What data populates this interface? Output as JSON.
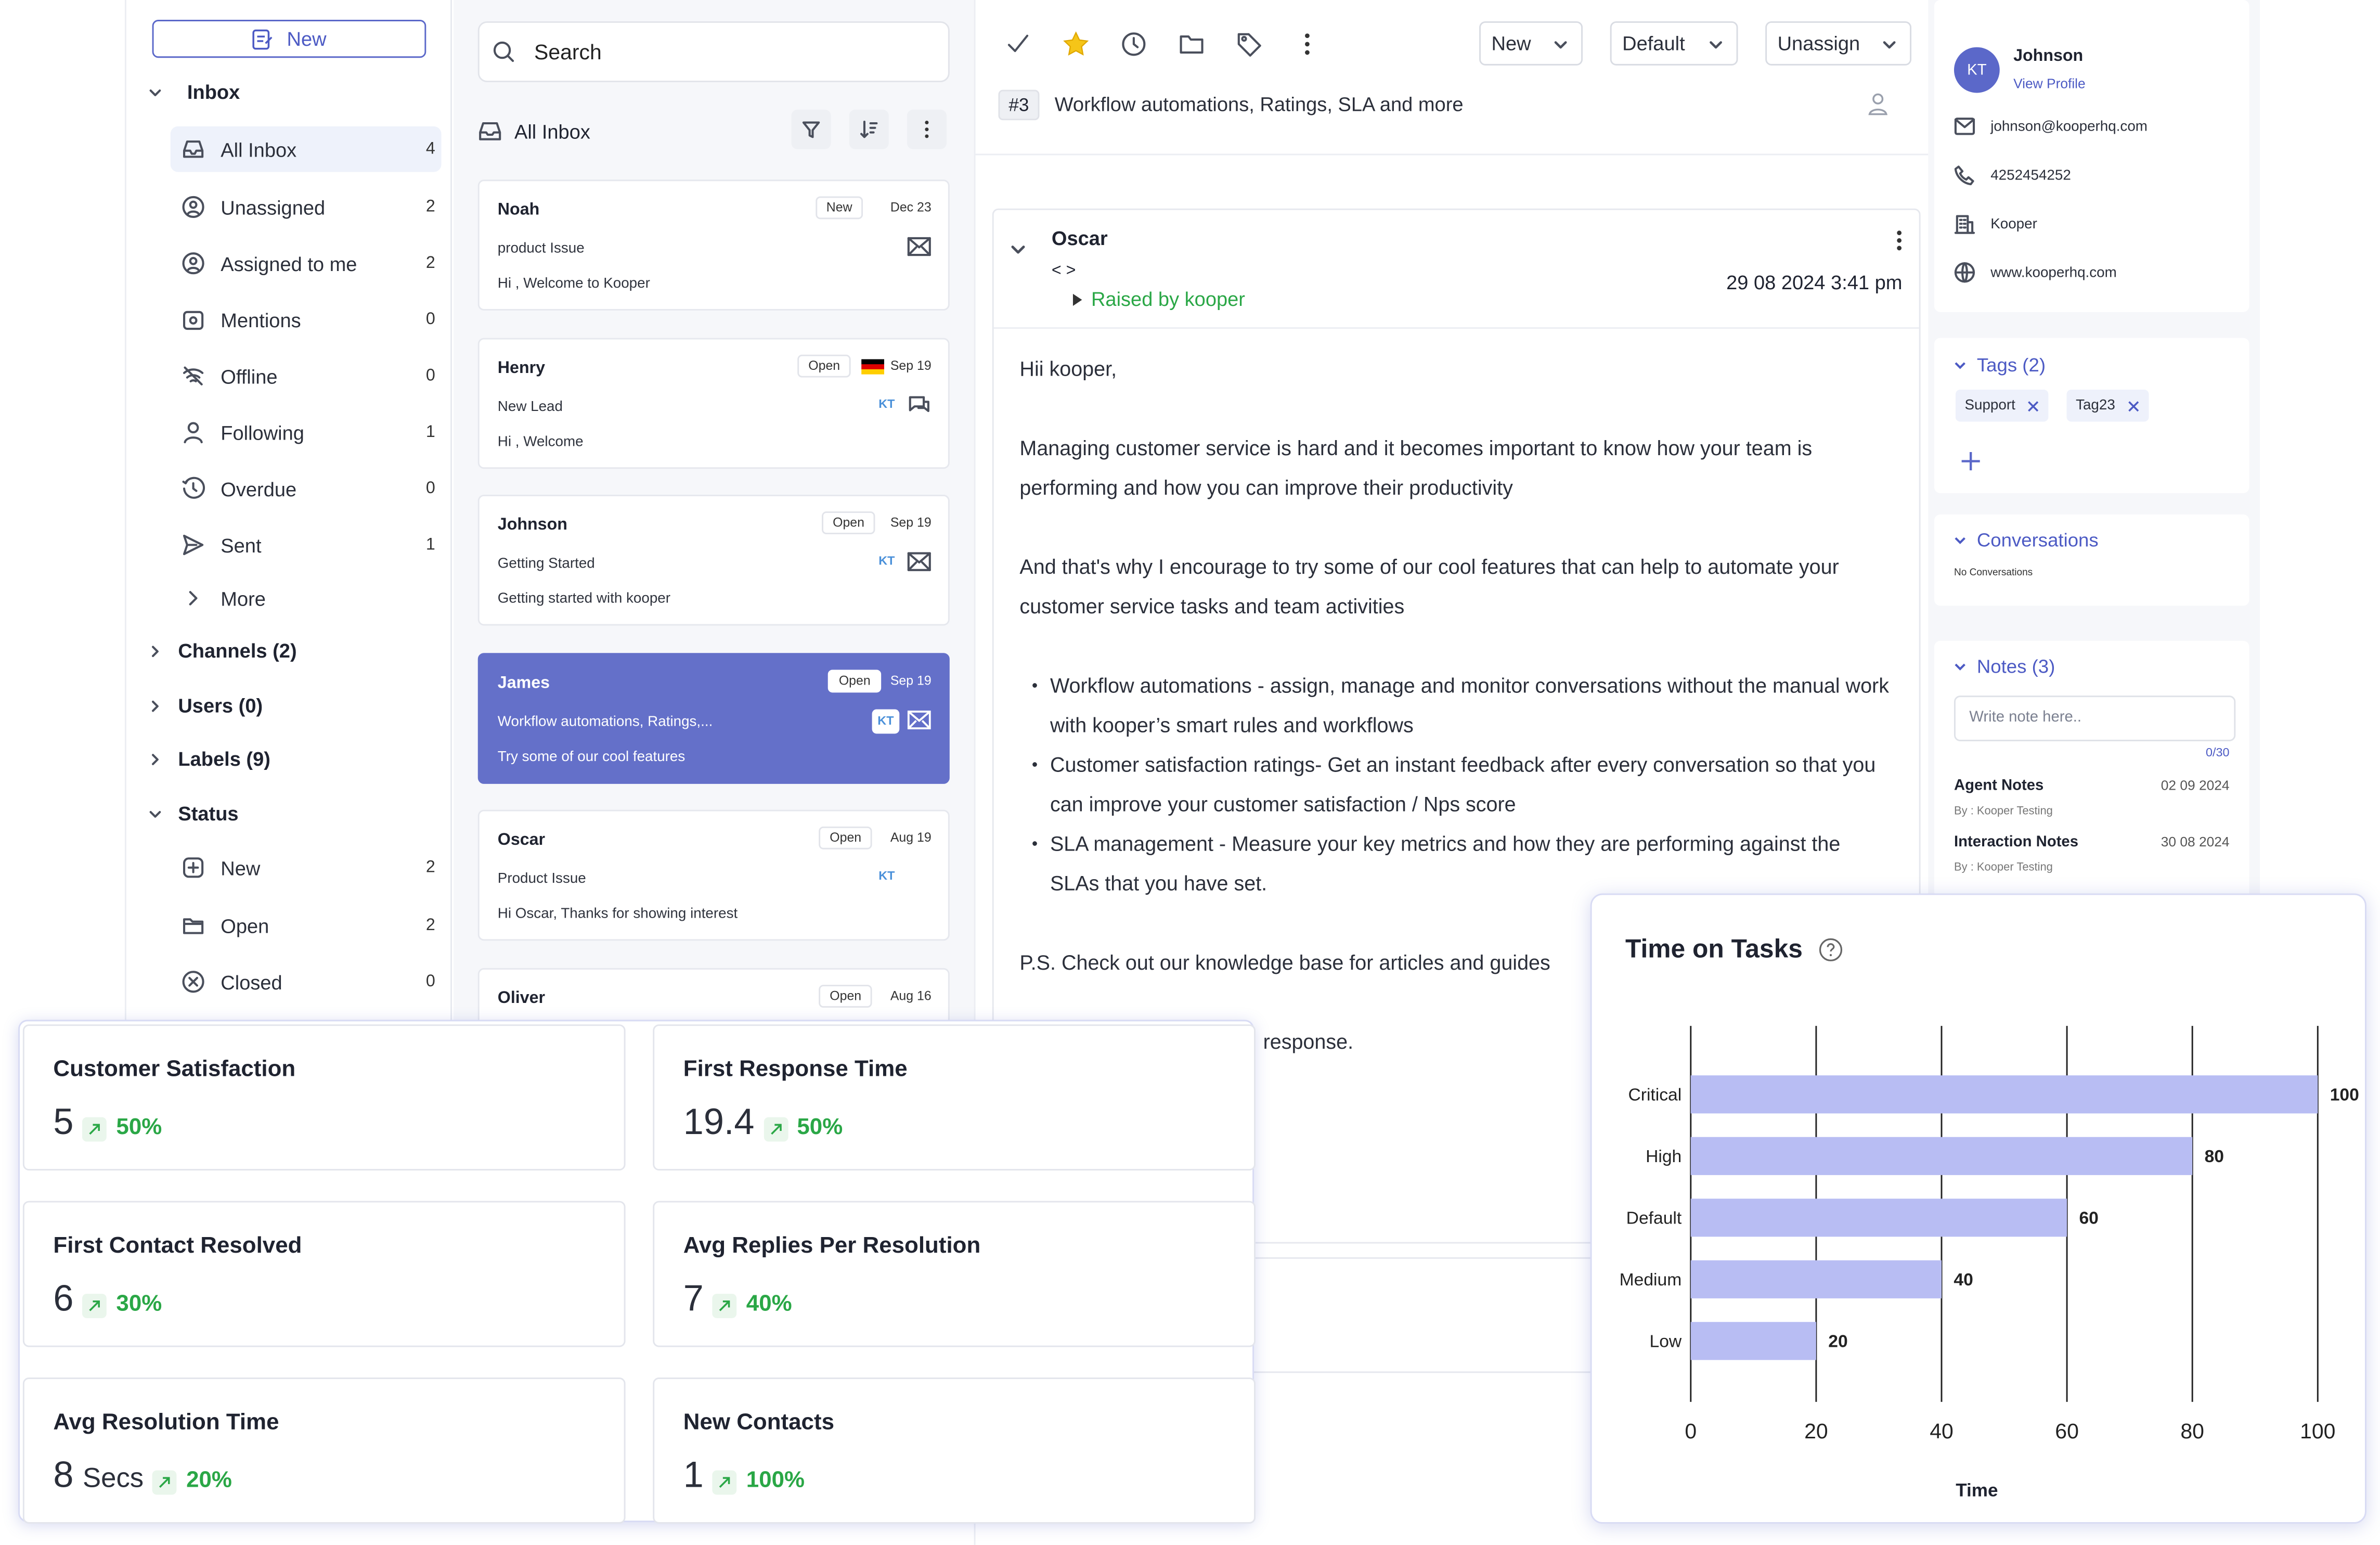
{
  "sidebar": {
    "new_label": "New",
    "inbox_label": "Inbox",
    "items": [
      {
        "label": "All Inbox",
        "count": "4"
      },
      {
        "label": "Unassigned",
        "count": "2"
      },
      {
        "label": "Assigned to me",
        "count": "2"
      },
      {
        "label": "Mentions",
        "count": "0"
      },
      {
        "label": "Offline",
        "count": "0"
      },
      {
        "label": "Following",
        "count": "1"
      },
      {
        "label": "Overdue",
        "count": "0"
      },
      {
        "label": "Sent",
        "count": "1"
      }
    ],
    "more_label": "More",
    "channels_label": "Channels (2)",
    "users_label": "Users (0)",
    "labels_label": "Labels (9)",
    "status_label": "Status",
    "status_items": [
      {
        "label": "New",
        "count": "2"
      },
      {
        "label": "Open",
        "count": "2"
      },
      {
        "label": "Closed",
        "count": "0"
      }
    ]
  },
  "list": {
    "search_placeholder": "Search",
    "title": "All Inbox",
    "cards": [
      {
        "name": "Noah",
        "status": "New",
        "date": "Dec 23",
        "subject": "product Issue",
        "preview": "Hi , Welcome to Kooper"
      },
      {
        "name": "Henry",
        "status": "Open",
        "date": "Sep 19",
        "subject": "New Lead",
        "preview": "Hi , Welcome",
        "kt": "KT"
      },
      {
        "name": "Johnson",
        "status": "Open",
        "date": "Sep 19",
        "subject": "Getting Started",
        "preview": "Getting started with kooper",
        "kt": "KT"
      },
      {
        "name": "James",
        "status": "Open",
        "date": "Sep 19",
        "subject": "Workflow automations, Ratings,...",
        "preview": "Try some of our cool features",
        "kt": "KT"
      },
      {
        "name": "Oscar",
        "status": "Open",
        "date": "Aug 19",
        "subject": "Product Issue",
        "preview": "Hi Oscar, Thanks for showing interest",
        "kt": "KT"
      },
      {
        "name": "Oliver",
        "status": "Open",
        "date": "Aug 16",
        "subject": "",
        "preview": ""
      }
    ]
  },
  "conversation": {
    "status_dd": "New",
    "priority_dd": "Default",
    "assign_dd": "Unassign",
    "ticket_no": "#3",
    "ticket_title": "Workflow automations, Ratings, SLA and more",
    "sender": "Oscar",
    "sender_email": "< >",
    "raised_by": "Raised by kooper",
    "timestamp": "29 08 2024 3:41 pm",
    "greeting": "Hii kooper,",
    "para1": "Managing customer service is hard and it becomes important to know how your team is performing and how you can improve their productivity",
    "para2": "And that's why I encourage to try some of our cool features that can help to automate your customer service tasks and team activities",
    "bullets": [
      "Workflow automations - assign, manage and monitor conversations without the manual work with kooper’s smart rules and workflows",
      "Customer satisfaction ratings- Get an instant feedback after every conversation so that you can improve your customer satisfaction / Nps score",
      "SLA management - Measure your key metrics and how they are performing against the SLAs that you have set."
    ],
    "ps": "P.S. Check out our knowledge base for articles and guides",
    "closing_fragment": "response."
  },
  "contact": {
    "initials": "KT",
    "name": "Johnson",
    "view_profile": "View Profile",
    "email": "johnson@kooperhq.com",
    "phone": "4252454252",
    "company": "Kooper",
    "website": "www.kooperhq.com",
    "tags_label": "Tags (2)",
    "tags": [
      "Support",
      "Tag23"
    ],
    "conversations_label": "Conversations",
    "no_conversations": "No Conversations",
    "notes_label": "Notes (3)",
    "note_placeholder": "Write note here..",
    "note_counter": "0/30",
    "notes": [
      {
        "title": "Agent Notes",
        "by": "By : Kooper Testing",
        "date": "02 09 2024"
      },
      {
        "title": "Interaction Notes",
        "by": "By : Kooper Testing",
        "date": "30 08 2024"
      }
    ]
  },
  "kpis": [
    {
      "title": "Customer Satisfaction",
      "value": "5",
      "unit": "",
      "change": "50%"
    },
    {
      "title": "First Response Time",
      "value": "19.4",
      "unit": "",
      "change": "50%"
    },
    {
      "title": "First Contact Resolved",
      "value": "6",
      "unit": "",
      "change": "30%"
    },
    {
      "title": "Avg Replies Per Resolution",
      "value": "7",
      "unit": "",
      "change": "40%"
    },
    {
      "title": "Avg Resolution Time",
      "value": "8",
      "unit": "Secs",
      "change": "20%"
    },
    {
      "title": "New Contacts",
      "value": "1",
      "unit": "",
      "change": "100%"
    }
  ],
  "colors": {
    "accent": "#5b68c9",
    "selected_card": "#6470c9",
    "bar": "#b8bdf3",
    "positive": "#2aa746"
  },
  "chart_data": {
    "type": "bar",
    "orientation": "horizontal",
    "title": "Time on Tasks",
    "categories": [
      "Critical",
      "High",
      "Default",
      "Medium",
      "Low"
    ],
    "values": [
      100,
      80,
      60,
      40,
      20
    ],
    "xlabel": "Time",
    "ylabel": "",
    "xlim": [
      0,
      100
    ],
    "xticks": [
      0,
      20,
      40,
      60,
      80,
      100
    ],
    "grid": true
  }
}
